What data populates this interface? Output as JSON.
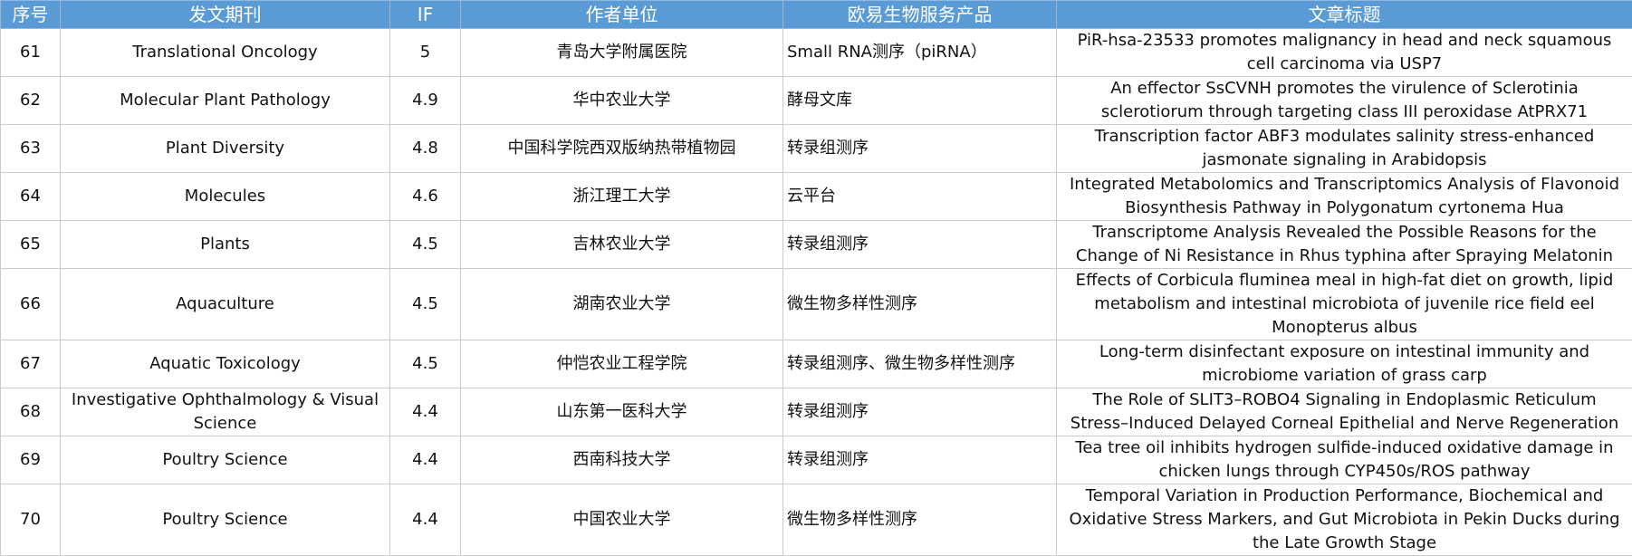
{
  "headers": [
    "序号",
    "发文期刊",
    "IF",
    "作者单位",
    "欧易生物服务产品",
    "文章标题"
  ],
  "rows": [
    {
      "no": "61",
      "journal": "Translational Oncology",
      "if": "5",
      "unit": "青岛大学附属医院",
      "product": "Small RNA测序（piRNA）",
      "title": "PiR-hsa-23533 promotes malignancy in head and neck squamous cell carcinoma via USP7"
    },
    {
      "no": "62",
      "journal": "Molecular Plant Pathology",
      "if": "4.9",
      "unit": "华中农业大学",
      "product": "酵母文库",
      "title": "An effector SsCVNH promotes the virulence of Sclerotinia sclerotiorum through targeting class III peroxidase AtPRX71"
    },
    {
      "no": "63",
      "journal": "Plant Diversity",
      "if": "4.8",
      "unit": "中国科学院西双版纳热带植物园",
      "product": "转录组测序",
      "title": "Transcription factor ABF3 modulates salinity stress-enhanced jasmonate signaling in Arabidopsis"
    },
    {
      "no": "64",
      "journal": "Molecules",
      "if": "4.6",
      "unit": "浙江理工大学",
      "product": "云平台",
      "title": "Integrated Metabolomics and Transcriptomics Analysis of Flavonoid Biosynthesis Pathway in Polygonatum cyrtonema Hua"
    },
    {
      "no": "65",
      "journal": "Plants",
      "if": "4.5",
      "unit": "吉林农业大学",
      "product": "转录组测序",
      "title": "Transcriptome Analysis Revealed the Possible Reasons for the Change of Ni Resistance in Rhus typhina after Spraying Melatonin"
    },
    {
      "no": "66",
      "journal": "Aquaculture",
      "if": "4.5",
      "unit": "湖南农业大学",
      "product": "微生物多样性测序",
      "title": "Effects of Corbicula fluminea meal in high-fat diet on growth, lipid metabolism and intestinal microbiota of juvenile rice field eel Monopterus albus"
    },
    {
      "no": "67",
      "journal": "Aquatic Toxicology",
      "if": "4.5",
      "unit": "仲恺农业工程学院",
      "product": "转录组测序、微生物多样性测序",
      "title": "Long-term disinfectant exposure on intestinal immunity and microbiome variation of grass carp"
    },
    {
      "no": "68",
      "journal": "Investigative Ophthalmology & Visual Science",
      "if": "4.4",
      "unit": "山东第一医科大学",
      "product": "转录组测序",
      "title": "The Role of SLIT3–ROBO4 Signaling in Endoplasmic Reticulum Stress–Induced Delayed Corneal Epithelial and Nerve Regeneration"
    },
    {
      "no": "69",
      "journal": "Poultry Science",
      "if": "4.4",
      "unit": "西南科技大学",
      "product": "转录组测序",
      "title": "Tea tree oil inhibits hydrogen sulfide-induced oxidative damage in chicken lungs through CYP450s/ROS pathway"
    },
    {
      "no": "70",
      "journal": "Poultry Science",
      "if": "4.4",
      "unit": "中国农业大学",
      "product": "微生物多样性测序",
      "title": "Temporal Variation in Production Performance, Biochemical and Oxidative Stress Markers, and Gut Microbiota in Pekin Ducks during the Late Growth Stage"
    }
  ]
}
